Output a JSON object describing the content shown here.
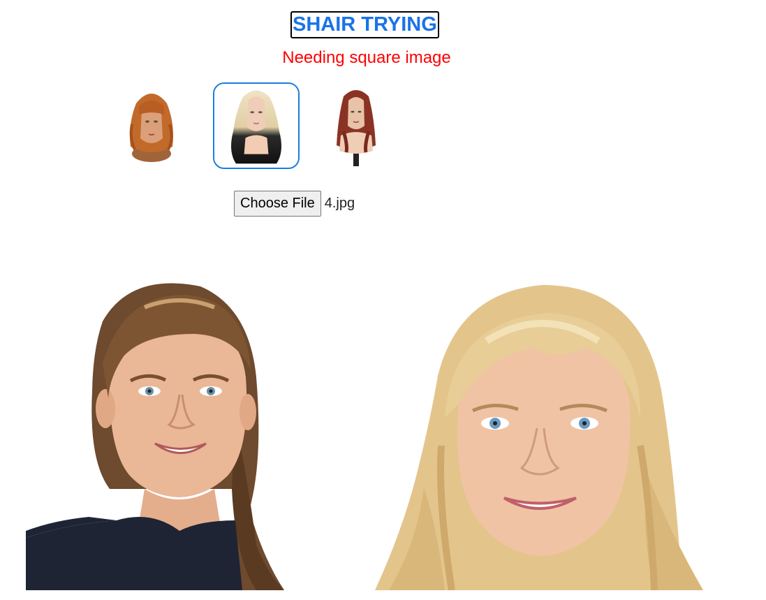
{
  "header": {
    "title": "SHAIR TRYING",
    "warning": "Needing square image"
  },
  "wigs": {
    "items": [
      {
        "name": "copper-bob-wig",
        "selected": false
      },
      {
        "name": "blonde-black-ombre-wig",
        "selected": true
      },
      {
        "name": "auburn-long-straight-wig",
        "selected": false
      }
    ]
  },
  "upload": {
    "button_label": "Choose File",
    "file_name": "4.jpg"
  },
  "colors": {
    "title": "#1a73e8",
    "warning": "#ff0000",
    "selected_border": "#1a7fe0"
  },
  "photos": {
    "input": "uploaded-portrait-brown-hair",
    "output": "result-portrait-blonde-hair"
  }
}
